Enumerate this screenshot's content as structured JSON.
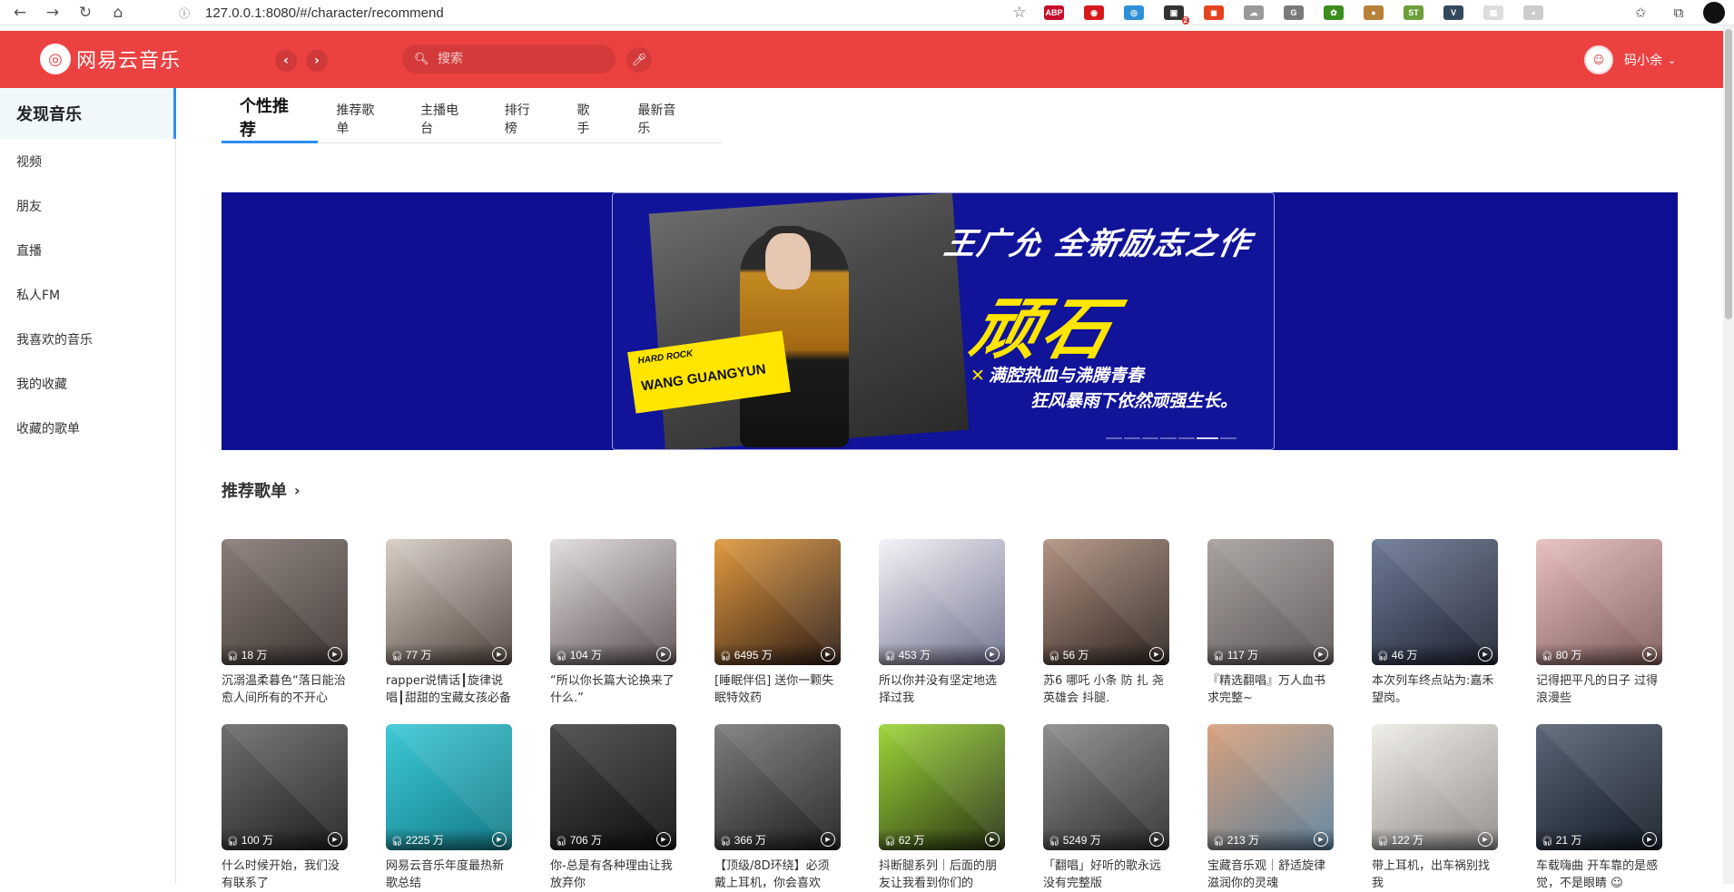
{
  "browser": {
    "url": "127.0.0.1:8080/#/character/recommend",
    "nav": [
      "←",
      "→",
      "↻",
      "⌂"
    ],
    "extensions": [
      {
        "name": "abp-extension-icon",
        "text": "ABP",
        "color": "#c70d2c"
      },
      {
        "name": "red-shield-extension-icon",
        "text": "◉",
        "color": "#d7191c"
      },
      {
        "name": "color-circle-extension-icon",
        "text": "◎",
        "color": "#2f8fd8"
      },
      {
        "name": "dark-extension-icon",
        "text": "▣",
        "color": "#333333",
        "badge": "2"
      },
      {
        "name": "office-extension-icon",
        "text": "◼",
        "color": "#e3431e"
      },
      {
        "name": "cloud-extension-icon",
        "text": "☁",
        "color": "#9a9a9a"
      },
      {
        "name": "grammar-extension-icon",
        "text": "G",
        "color": "#7a7a7a"
      },
      {
        "name": "green-extension-icon",
        "text": "✿",
        "color": "#3b8e1d"
      },
      {
        "name": "cookie-extension-icon",
        "text": "●",
        "color": "#b7813a"
      },
      {
        "name": "st-extension-icon",
        "text": "ST",
        "color": "#6c9e3a"
      },
      {
        "name": "vue-extension-icon",
        "text": "V",
        "color": "#35495e"
      },
      {
        "name": "gray-extension-icon",
        "text": "▦",
        "color": "#dddddd"
      },
      {
        "name": "puppy-extension-icon",
        "text": "◕",
        "color": "#cccccc"
      }
    ]
  },
  "header": {
    "app_name": "网易云音乐",
    "logo_glyph": "◎",
    "search_placeholder": "搜索",
    "user_name": "码小余",
    "brand_color": "#ec4141"
  },
  "sidebar": {
    "items": [
      {
        "label": "发现音乐",
        "active": true
      },
      {
        "label": "视频"
      },
      {
        "label": "朋友"
      },
      {
        "label": "直播"
      },
      {
        "label": "私人FM"
      },
      {
        "label": "我喜欢的音乐"
      },
      {
        "label": "我的收藏"
      },
      {
        "label": "收藏的歌单"
      }
    ]
  },
  "tabs": [
    "个性推荐",
    "推荐歌单",
    "主播电台",
    "排行榜",
    "歌手",
    "最新音乐"
  ],
  "banner": {
    "bg_text": "WANG GUANGYUN",
    "subtitle": "王广允 全新励志之作",
    "title": "顽石",
    "line1": "满腔热血与沸腾青春",
    "line2": "狂风暴雨下依然顽强生长。",
    "tag_top": "HARD ROCK",
    "tag_name": "WANG GUANGYUN",
    "dot_count": 7,
    "active_dot": 5
  },
  "section": {
    "title": "推荐歌单",
    "arrow": "›"
  },
  "playlists": [
    {
      "count": "18 万",
      "label": "沉溺温柔暮色“落日能治愈人间所有的不开心",
      "c1": "#8a7d76",
      "c2": "#3c3432"
    },
    {
      "count": "77 万",
      "label": "rapper说情话┃旋律说唱┃甜甜的宝藏女孩必备",
      "c1": "#d9cfc7",
      "c2": "#4e413a"
    },
    {
      "count": "104 万",
      "label": "“所以你长篇大论换来了什么.”",
      "c1": "#e2dede",
      "c2": "#5a4e4f"
    },
    {
      "count": "6495 万",
      "label": "[睡眠伴侣] 送你一颗失眠特效药",
      "c1": "#e29a3f",
      "c2": "#2c1b16"
    },
    {
      "count": "453 万",
      "label": "所以你并没有坚定地选择过我",
      "c1": "#f4f4f8",
      "c2": "#6b6d8a"
    },
    {
      "count": "56 万",
      "label": "苏6 哪吒 小条 防 扎 尧 英雄会 抖腿.",
      "c1": "#b39483",
      "c2": "#2d2420"
    },
    {
      "count": "117 万",
      "label": "『精选翻唱』万人血书求完整~",
      "c1": "#a8a2a0",
      "c2": "#5c5555"
    },
    {
      "count": "46 万",
      "label": "本次列车终点站为:嘉禾望岗。",
      "c1": "#6e7b96",
      "c2": "#1e2231"
    },
    {
      "count": "80 万",
      "label": "记得把平凡的日子 过得浪漫些",
      "c1": "#e8c0c0",
      "c2": "#7c5b58"
    },
    {
      "count": "100 万",
      "label": "什么时候开始，我们没有联系了",
      "c1": "#6f6f6f",
      "c2": "#1e1e1e"
    },
    {
      "count": "2225 万",
      "label": "网易云音乐年度最热新歌总结",
      "c1": "#3ec9d6",
      "c2": "#127a86"
    },
    {
      "count": "706 万",
      "label": "你-总是有各种理由让我放弃你",
      "c1": "#4a4a4a",
      "c2": "#0e0e0e"
    },
    {
      "count": "366 万",
      "label": "【顶级/8D环绕】必须戴上耳机，你会喜欢",
      "c1": "#7e7e7e",
      "c2": "#1c1c1c"
    },
    {
      "count": "62 万",
      "label": "抖断腿系列｜后面的朋友让我看到你们的",
      "c1": "#9fd63a",
      "c2": "#263312"
    },
    {
      "count": "5249 万",
      "label": "「翻唱」好听的歌永远没有完整版",
      "c1": "#8e8e8e",
      "c2": "#2b2b2b"
    },
    {
      "count": "213 万",
      "label": "宝藏音乐观｜舒适旋律滋润你的灵魂",
      "c1": "#d9a27e",
      "c2": "#5a7f9a"
    },
    {
      "count": "122 万",
      "label": "带上耳机，出车祸别找我",
      "c1": "#f0eee8",
      "c2": "#8d8a87"
    },
    {
      "count": "21 万",
      "label": "车载嗨曲 开车靠的是感觉，不是眼睛 ☺",
      "c1": "#5b6677",
      "c2": "#111a24"
    }
  ]
}
